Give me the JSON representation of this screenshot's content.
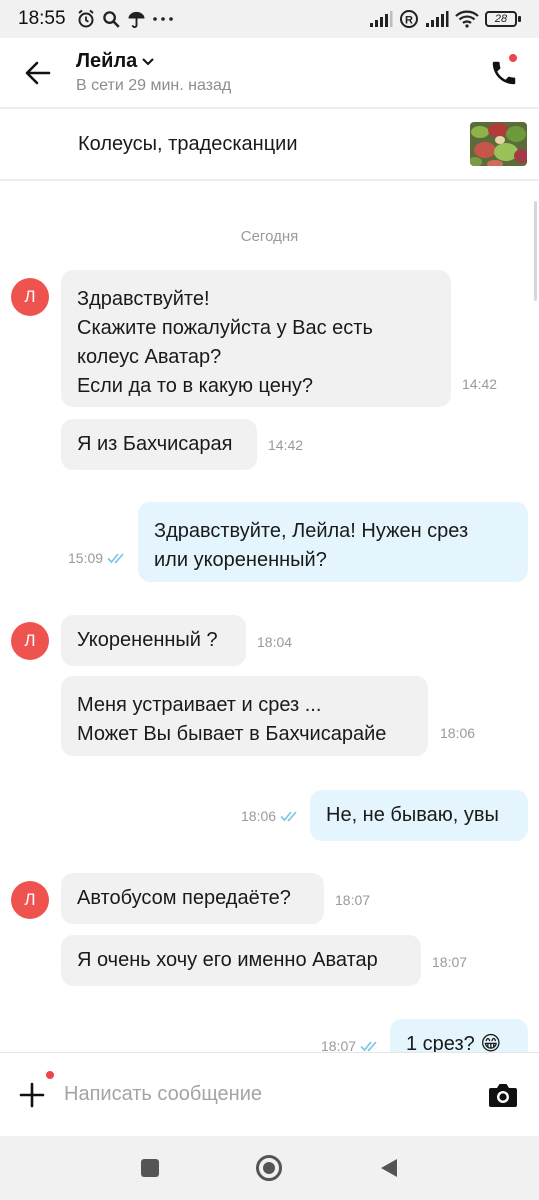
{
  "status_bar": {
    "time": "18:55",
    "battery": "28",
    "icons": [
      "alarm-icon",
      "search-icon",
      "umbrella-icon",
      "more-icon",
      "signal-icon",
      "roaming-icon",
      "signal-icon",
      "wifi-icon",
      "battery-icon"
    ]
  },
  "header": {
    "name": "Лейла",
    "status": "В сети 29 мин. назад"
  },
  "listing": {
    "title": "Колеусы, традесканции"
  },
  "chat": {
    "date": "Сегодня",
    "avatar_letter": "Л",
    "messages": [
      {
        "dir": "in",
        "lines": [
          "Здравствуйте!",
          "Скажите пожалуйста у Вас есть",
          "колеус Аватар?",
          "Если да то в какую цену?"
        ],
        "time": "14:42"
      },
      {
        "dir": "in",
        "lines": [
          "Я из Бахчисарая"
        ],
        "time": "14:42"
      },
      {
        "dir": "out",
        "lines": [
          "Здравствуйте, Лейла! Нужен срез",
          "или укорененный?"
        ],
        "time": "15:09"
      },
      {
        "dir": "in",
        "lines": [
          "Укорененный ?"
        ],
        "time": "18:04"
      },
      {
        "dir": "in",
        "lines": [
          "Меня устраивает и срез ...",
          "Может Вы бывает в Бахчисарайе"
        ],
        "time": "18:06"
      },
      {
        "dir": "out",
        "lines": [
          "Не, не бываю, увы"
        ],
        "time": "18:06"
      },
      {
        "dir": "in",
        "lines": [
          "Автобусом передаёте?"
        ],
        "time": "18:07"
      },
      {
        "dir": "in",
        "lines": [
          "Я очень хочу его именно Аватар"
        ],
        "time": "18:07"
      },
      {
        "dir": "out",
        "lines": [
          "1 срез? 😁"
        ],
        "time": "18:07"
      }
    ]
  },
  "composer": {
    "placeholder": "Написать сообщение"
  },
  "colors": {
    "accent_red": "#ef5350",
    "incoming_bubble": "#f1f1f1",
    "outgoing_bubble": "#e4f5fd",
    "read_check": "#7ac4e6"
  }
}
